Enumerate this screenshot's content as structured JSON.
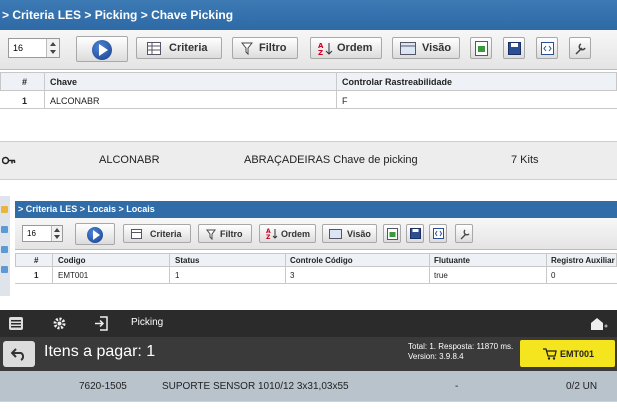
{
  "panel1": {
    "breadcrumb": "> Criteria LES > Picking > Chave Picking",
    "page_size": "16",
    "toolbar": {
      "criteria": "Criteria",
      "filtro": "Filtro",
      "ordem": "Ordem",
      "visao": "Visão"
    },
    "columns": [
      "#",
      "Chave",
      "Controlar Rastreabilidade"
    ],
    "rows": [
      {
        "num": "1",
        "chave": "ALCONABR",
        "rastreabilidade": "F"
      }
    ]
  },
  "panel2": {
    "code": "ALCONABR",
    "description": "ABRAÇADEIRAS Chave de picking",
    "quantity": "7 Kits"
  },
  "panel3": {
    "breadcrumb": "> Criteria LES > Locais > Locais",
    "page_size": "16",
    "toolbar": {
      "criteria": "Criteria",
      "filtro": "Filtro",
      "ordem": "Ordem",
      "visao": "Visão"
    },
    "columns": [
      "#",
      "Codigo",
      "Status",
      "Controle Código",
      "Flutuante",
      "Registro Auxiliar"
    ],
    "rows": [
      {
        "num": "1",
        "codigo": "EMT001",
        "status": "1",
        "controle": "3",
        "flutuante": "true",
        "registro": "0"
      }
    ]
  },
  "panel4": {
    "app_title": "Picking",
    "items_label": "Itens a pagar: 1",
    "total_info": "Total: 1. Resposta: 11870 ms.",
    "version": "Version: 3.9.8.4",
    "cart_button": "EMT001",
    "row": {
      "code": "7620-1505",
      "description": "SUPORTE SENSOR 1010/12 3x31,03x55",
      "dash": "-",
      "qty": "0/2 UN"
    }
  },
  "icons": {
    "colors": {
      "title_blue": "#2d6aa6",
      "cart_yellow": "#f5e51f",
      "dark_bar": "#2b2b2b",
      "row_gray": "#b9c3cc"
    }
  }
}
